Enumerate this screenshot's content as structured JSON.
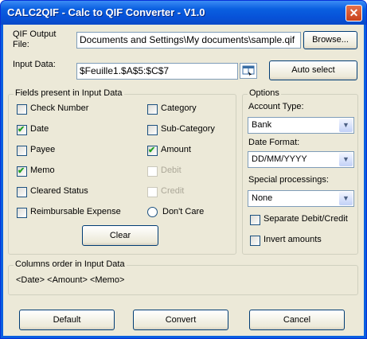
{
  "window": {
    "title": "CALC2QIF - Calc to QIF Converter - V1.0",
    "close_glyph": "✕"
  },
  "qif_output": {
    "label_line1": "QIF Output",
    "label_line2": "File:",
    "value": "Documents and Settings\\My documents\\sample.qif",
    "browse_label": "Browse..."
  },
  "input_data": {
    "label": "Input Data:",
    "value": "$Feuille1.$A$5:$C$7",
    "picker_icon": "range-picker-icon",
    "auto_select_label": "Auto select"
  },
  "fields_group": {
    "legend": "Fields present in Input Data",
    "left_items": [
      {
        "label": "Check Number",
        "checked": false,
        "enabled": true
      },
      {
        "label": "Date",
        "checked": true,
        "enabled": true
      },
      {
        "label": "Payee",
        "checked": false,
        "enabled": true
      },
      {
        "label": "Memo",
        "checked": true,
        "enabled": true
      },
      {
        "label": "Cleared Status",
        "checked": false,
        "enabled": true
      },
      {
        "label": "Reimbursable Expense",
        "checked": false,
        "enabled": true
      }
    ],
    "right_items": [
      {
        "label": "Category",
        "checked": false,
        "enabled": true
      },
      {
        "label": "Sub-Category",
        "checked": false,
        "enabled": true
      },
      {
        "label": "Amount",
        "checked": true,
        "enabled": true
      },
      {
        "label": "Debit",
        "checked": false,
        "enabled": false
      },
      {
        "label": "Credit",
        "checked": false,
        "enabled": false
      }
    ],
    "dont_care_label": "Don't Care",
    "clear_label": "Clear"
  },
  "options_group": {
    "legend": "Options",
    "account_type_label": "Account Type:",
    "account_type_value": "Bank",
    "date_format_label": "Date Format:",
    "date_format_value": "DD/MM/YYYY",
    "special_label": "Special processings:",
    "special_value": "None",
    "separate_label": "Separate Debit/Credit",
    "invert_label": "Invert amounts"
  },
  "columns_group": {
    "legend": "Columns order in Input Data",
    "text": "<Date> <Amount> <Memo>"
  },
  "footer": {
    "default_label": "Default",
    "convert_label": "Convert",
    "cancel_label": "Cancel"
  },
  "colors": {
    "titlebar": "#0a5fe0",
    "face": "#ece9d8",
    "check_mark": "#21a121"
  }
}
